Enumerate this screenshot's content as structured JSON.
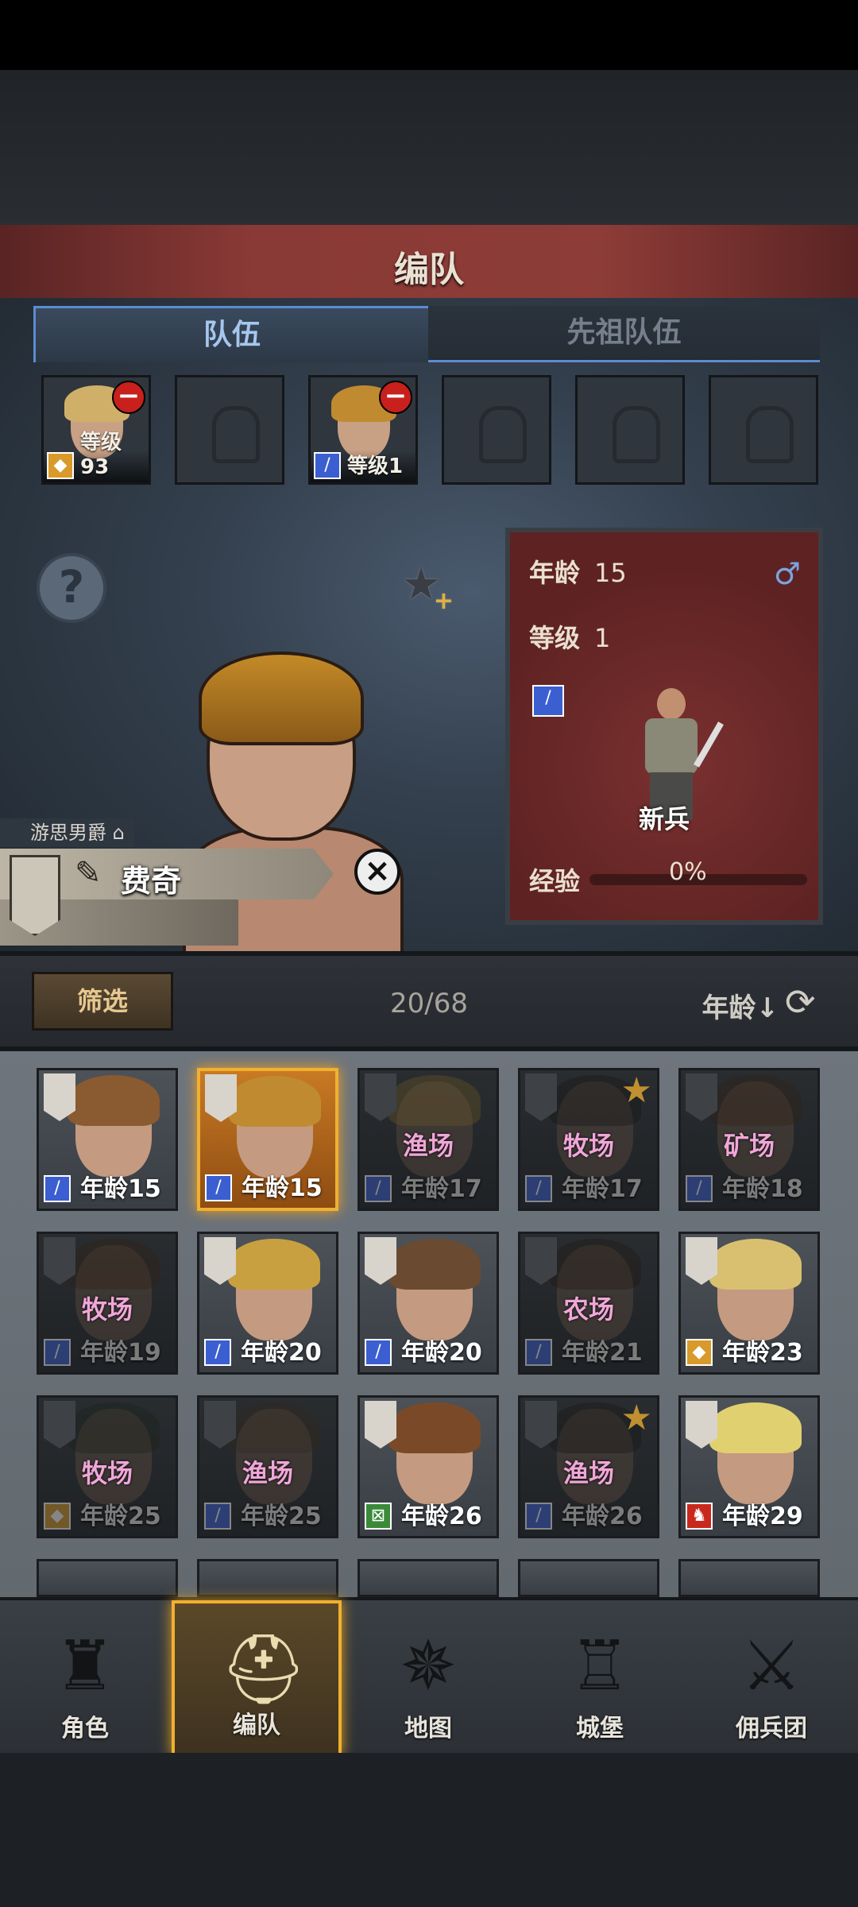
{
  "header": {
    "title": "编队"
  },
  "tabs": [
    {
      "label": "队伍",
      "active": true
    },
    {
      "label": "先祖队伍",
      "active": false
    }
  ],
  "party_slots": [
    {
      "filled": true,
      "class_icon": "shield-icon",
      "level_text": "等级93",
      "hair": "#d0b068"
    },
    {
      "filled": false
    },
    {
      "filled": true,
      "class_icon": "sword-icon",
      "level_text": "等级1",
      "hair": "#c08a30"
    },
    {
      "filled": false
    },
    {
      "filled": false
    },
    {
      "filled": false
    }
  ],
  "hero": {
    "title": "游思男爵",
    "name": "费奇"
  },
  "info_card": {
    "age_label": "年龄",
    "age_value": "15",
    "level_label": "等级",
    "level_value": "1",
    "class_icon": "sword-icon",
    "class_name": "新兵",
    "exp_label": "经验",
    "exp_percent": "0%",
    "exp_fraction": 0,
    "gender": "male"
  },
  "filter_bar": {
    "filter_label": "筛选",
    "count": "20/68",
    "sort_label": "年龄↓"
  },
  "roster": [
    {
      "age": "年龄15",
      "job": "",
      "class_icon": "sword",
      "dim": false,
      "selected": false,
      "star": false,
      "hair": "#8a5a30"
    },
    {
      "age": "年龄15",
      "job": "",
      "class_icon": "sword",
      "dim": false,
      "selected": true,
      "star": false,
      "hair": "#c08a30"
    },
    {
      "age": "年龄17",
      "job": "渔场",
      "class_icon": "sword",
      "dim": true,
      "selected": false,
      "star": false,
      "hair": "#c8a040"
    },
    {
      "age": "年龄17",
      "job": "牧场",
      "class_icon": "sword",
      "dim": true,
      "selected": false,
      "star": true,
      "hair": "#222222"
    },
    {
      "age": "年龄18",
      "job": "矿场",
      "class_icon": "sword",
      "dim": true,
      "selected": false,
      "star": false,
      "hair": "#5a3a20"
    },
    {
      "age": "年龄19",
      "job": "牧场",
      "class_icon": "sword",
      "dim": true,
      "selected": false,
      "star": false,
      "hair": "#5a3a20"
    },
    {
      "age": "年龄20",
      "job": "",
      "class_icon": "sword",
      "dim": false,
      "selected": false,
      "star": false,
      "hair": "#c8a040"
    },
    {
      "age": "年龄20",
      "job": "",
      "class_icon": "sword",
      "dim": false,
      "selected": false,
      "star": false,
      "hair": "#6a4a30"
    },
    {
      "age": "年龄21",
      "job": "农场",
      "class_icon": "sword",
      "dim": true,
      "selected": false,
      "star": false,
      "hair": "#3a2a20"
    },
    {
      "age": "年龄23",
      "job": "",
      "class_icon": "shield",
      "dim": false,
      "selected": false,
      "star": false,
      "hair": "#d8c070"
    },
    {
      "age": "年龄25",
      "job": "牧场",
      "class_icon": "shield",
      "dim": true,
      "selected": false,
      "star": false,
      "hair": "#2a3a2a"
    },
    {
      "age": "年龄25",
      "job": "渔场",
      "class_icon": "sword",
      "dim": true,
      "selected": false,
      "star": false,
      "hair": "#5a4a30"
    },
    {
      "age": "年龄26",
      "job": "",
      "class_icon": "bow",
      "dim": false,
      "selected": false,
      "star": false,
      "hair": "#7a4a28"
    },
    {
      "age": "年龄26",
      "job": "渔场",
      "class_icon": "sword",
      "dim": true,
      "selected": false,
      "star": true,
      "hair": "#222222"
    },
    {
      "age": "年龄29",
      "job": "",
      "class_icon": "horse",
      "dim": false,
      "selected": false,
      "star": false,
      "hair": "#e0d070"
    }
  ],
  "nav": [
    {
      "label": "角色",
      "icon": "knight-icon",
      "active": false
    },
    {
      "label": "编队",
      "icon": "helmet-icon",
      "active": true
    },
    {
      "label": "地图",
      "icon": "compass-icon",
      "active": false
    },
    {
      "label": "城堡",
      "icon": "castle-icon",
      "active": false
    },
    {
      "label": "佣兵团",
      "icon": "mercenary-icon",
      "active": false
    }
  ]
}
